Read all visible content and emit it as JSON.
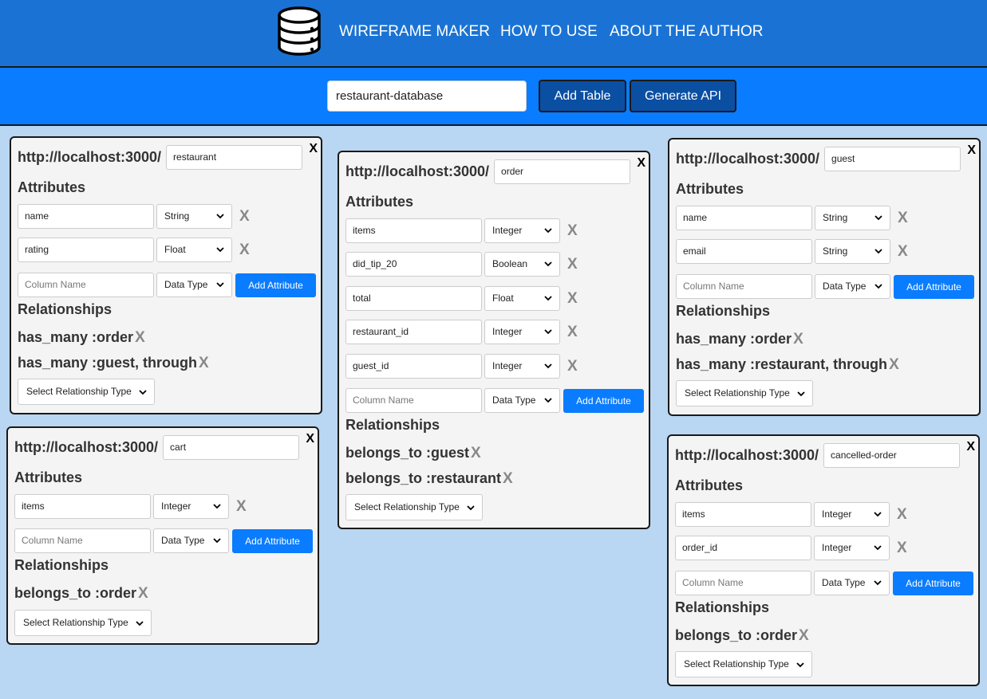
{
  "nav": {
    "maker": "WIREFRAME MAKER",
    "howto": "HOW TO USE",
    "about": "ABOUT THE AUTHOR"
  },
  "toolbar": {
    "db_name": "restaurant-database",
    "add_table": "Add Table",
    "generate_api": "Generate API"
  },
  "common": {
    "url_prefix": "http://localhost:3000/",
    "attributes_title": "Attributes",
    "relationships_title": "Relationships",
    "column_placeholder": "Column Name",
    "type_placeholder": "Data Type",
    "add_attribute": "Add Attribute",
    "rel_select": "Select Relationship Type",
    "close": "X",
    "delete": "X"
  },
  "tables": {
    "restaurant": {
      "name": "restaurant",
      "attributes": [
        {
          "name": "name",
          "type": "String"
        },
        {
          "name": "rating",
          "type": "Float"
        }
      ],
      "relationships": [
        "has_many :order",
        "has_many :guest, through"
      ]
    },
    "cart": {
      "name": "cart",
      "attributes": [
        {
          "name": "items",
          "type": "Integer"
        }
      ],
      "relationships": [
        "belongs_to :order"
      ]
    },
    "order": {
      "name": "order",
      "attributes": [
        {
          "name": "items",
          "type": "Integer"
        },
        {
          "name": "did_tip_20",
          "type": "Boolean"
        },
        {
          "name": "total",
          "type": "Float"
        },
        {
          "name": "restaurant_id",
          "type": "Integer"
        },
        {
          "name": "guest_id",
          "type": "Integer"
        }
      ],
      "relationships": [
        "belongs_to :guest",
        "belongs_to :restaurant"
      ]
    },
    "guest": {
      "name": "guest",
      "attributes": [
        {
          "name": "name",
          "type": "String"
        },
        {
          "name": "email",
          "type": "String"
        }
      ],
      "relationships": [
        "has_many :order",
        "has_many :restaurant, through"
      ]
    },
    "cancelled": {
      "name": "cancelled-order",
      "attributes": [
        {
          "name": "items",
          "type": "Integer"
        },
        {
          "name": "order_id",
          "type": "Integer"
        }
      ],
      "relationships": [
        "belongs_to :order"
      ]
    }
  }
}
